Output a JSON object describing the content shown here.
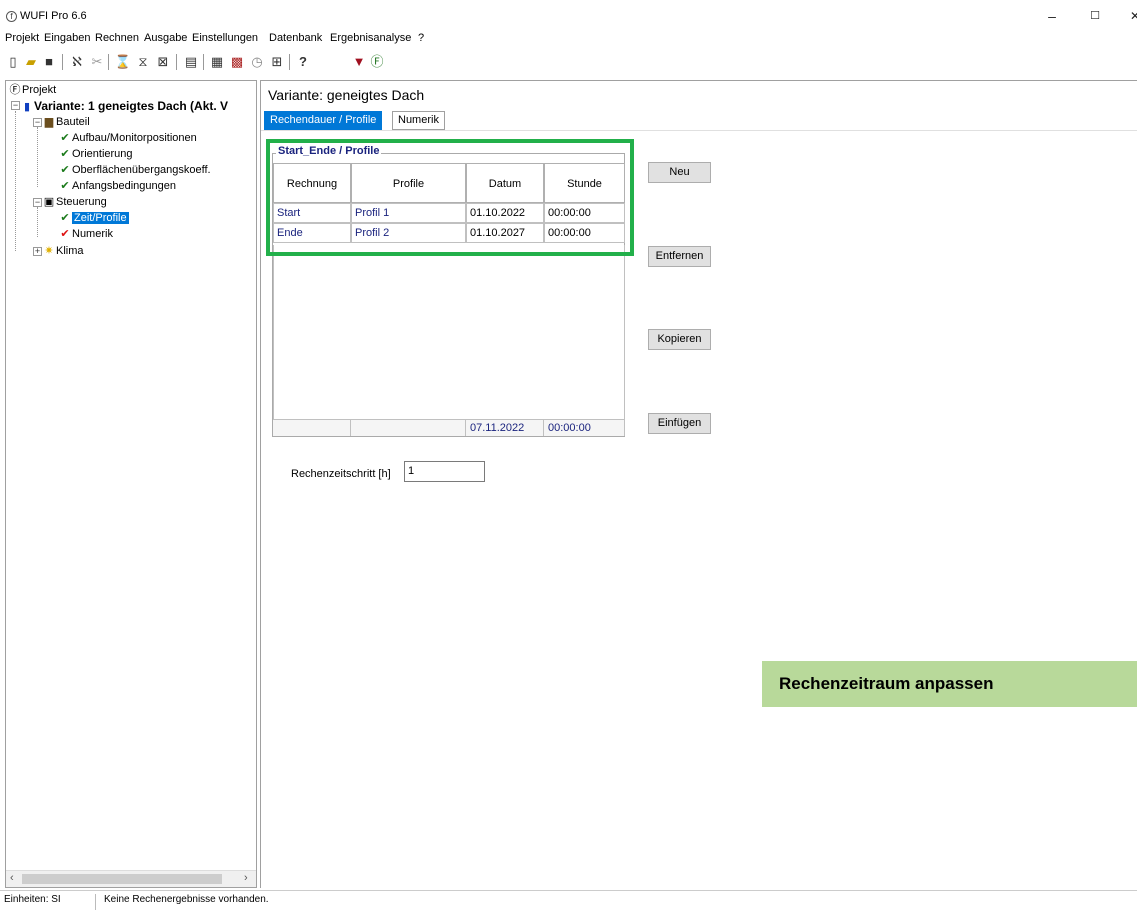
{
  "window": {
    "title": "WUFI Pro 6.6",
    "minimize": "–",
    "maximize": "☐",
    "close": "✕"
  },
  "menu": [
    "Projekt",
    "Eingaben",
    "Rechnen",
    "Ausgabe",
    "Einstellungen",
    "Datenbank",
    "Ergebnisanalyse",
    "?"
  ],
  "toolbar": {
    "help": "?"
  },
  "tree": {
    "project": "Projekt",
    "variant": "Variante: 1 geneigtes Dach (Akt. V",
    "bauteil": "Bauteil",
    "aufbau": "Aufbau/Monitorpositionen",
    "orientierung": "Orientierung",
    "oberflaeche": "Oberflächenübergangskoeff.",
    "anfang": "Anfangsbedingungen",
    "steuerung": "Steuerung",
    "zeit": "Zeit/Profile",
    "numerik": "Numerik",
    "klima": "Klima"
  },
  "main": {
    "variant_title": "Variante:  geneigtes Dach",
    "tabs": [
      "Rechendauer / Profile",
      "Numerik"
    ],
    "group_title": "Start_Ende / Profile",
    "columns": [
      "Rechnung",
      "Profile",
      "Datum",
      "Stunde"
    ],
    "rows": [
      [
        "Start",
        "Profil 1",
        "01.10.2022",
        "00:00:00"
      ],
      [
        "Ende",
        "Profil 2",
        "01.10.2027",
        "00:00:00"
      ]
    ],
    "footer_date": "07.11.2022",
    "footer_time": "00:00:00",
    "buttons": {
      "neu": "Neu",
      "entfernen": "Entfernen",
      "kopieren": "Kopieren",
      "einfuegen": "Einfügen"
    },
    "rechenzeitschritt_label": "Rechenzeitschritt [h]",
    "rechenzeitschritt_value": "1",
    "banner": "Rechenzeitraum anpassen"
  },
  "status": {
    "units": "Einheiten: SI",
    "message": "Keine Rechenergebnisse vorhanden."
  },
  "colors": {
    "accent": "#0078d7",
    "highlight": "#22b04a",
    "banner": "#b8d99a"
  }
}
